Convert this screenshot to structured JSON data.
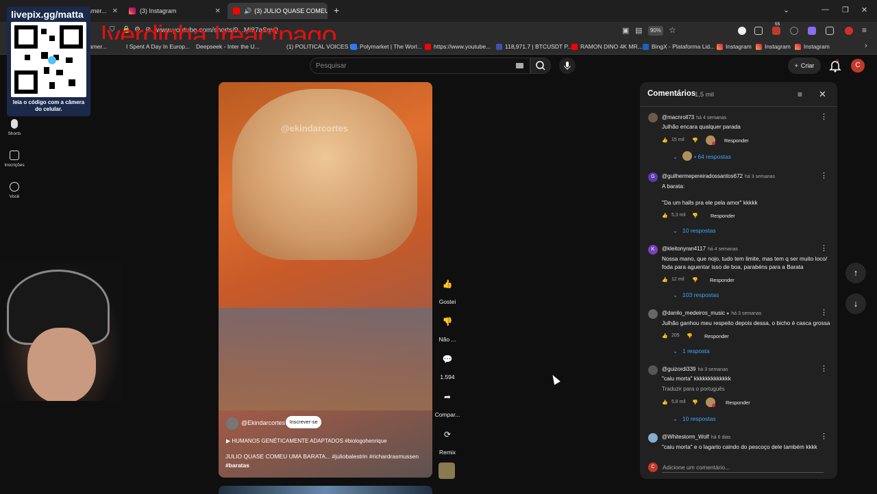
{
  "browser": {
    "tabs": [
      {
        "label": "amer..."
      },
      {
        "label": "(3) Instagram"
      },
      {
        "label": "(3) JULIO QUASE COMEU U"
      }
    ],
    "new_tab": "+",
    "url": "www.youtube.com/shorts/9...Mi87aSmQ",
    "zoom": "90%",
    "notification_ext_count": "55",
    "bookmarks": [
      "amer...",
      "I Spent A Day In Europ...",
      "Deepseek - Inter the U...",
      "(1) POLITICAL VOICES E...",
      "Polymarket | The Worl...",
      "https://www.youtube...",
      "118,971.7 | BTCUSDT P...",
      "RAMON DINO 4K MR...",
      "BingX - Plataforma Lid...",
      "Instagram",
      "Instagram",
      "Instagram"
    ]
  },
  "overlay": {
    "red_text": "!verdinha !reactpago",
    "qr_title": "livepix.gg/matta",
    "qr_caption": "leia o código com a câmera do celular."
  },
  "youtube": {
    "search_placeholder": "Pesquisar",
    "create_label": "Criar",
    "notif_count": "3",
    "avatar_letter": "C",
    "left_nav": [
      {
        "label": "Shorts"
      },
      {
        "label": "Inscrições"
      },
      {
        "label": "Você"
      }
    ]
  },
  "video": {
    "watermark": "@ekindarcortes",
    "channel": "@Ekindarcortes",
    "subscribe": "Inscrever-se",
    "song": "HUMANOS GENÉTICAMENTE ADAPTADOS #biologohenrique",
    "title_line1": "JULIO QUASE COMEU UMA BARATA... #juliobalestrin #richardrasmussen",
    "title_line2": "#baratas"
  },
  "actions": {
    "like": "Gostei",
    "dislike": "Não ...",
    "comments": "1.594",
    "share": "Compar...",
    "remix": "Remix"
  },
  "comments": {
    "title": "Comentários",
    "count": "1,5 mil",
    "input_placeholder": "Adicione um comentário...",
    "reply_label": "Responder",
    "translate_label": "Traduzir para o português",
    "items": [
      {
        "user": "@macnroll73",
        "time": "há 4 semanas",
        "text1": "Julhão encara qualquer parada",
        "text2": "",
        "text3": "",
        "likes": "15 mil",
        "more": "• 64 respostas",
        "avatar": "",
        "avatar_color": "#6b5b4b"
      },
      {
        "user": "@guilhermepereiradossantos672",
        "time": "há 3 semanas",
        "text1": "A barata:",
        "text2": "",
        "text3": "\"Da um halls pra ele pela amor\" kkkkk",
        "likes": "5,3 mil",
        "more": "10 respostas",
        "avatar": "G",
        "avatar_color": "#5b3bb0"
      },
      {
        "user": "@kleitonyran4117",
        "time": "há 4 semanas",
        "text1": "Nossa mano, que nojo, tudo tem limite, mas tem q ser muito loco/",
        "text2": "foda para aguentar isso de boa, parabéns para a Barata",
        "text3": "",
        "likes": "12 mil",
        "more": "103 respostas",
        "avatar": "K",
        "avatar_color": "#7b3fc0"
      },
      {
        "user": "@danilo_medeiros_music",
        "time": "há 3 semanas",
        "text1": "Julhão ganhou meu respeito depois dessa, o bicho é casca grossa",
        "text2": "",
        "text3": "",
        "likes": "205",
        "more": "1 resposta",
        "avatar": "",
        "avatar_color": "#666"
      },
      {
        "user": "@guizordi339",
        "time": "há 3 semanas",
        "text1": "\"caiu morta\" kkkkkkkkkkkkk",
        "text2": "",
        "text3": "",
        "likes": "5,8 mil",
        "more": "10 respostas",
        "avatar": "",
        "avatar_color": "#555"
      },
      {
        "user": "@Whitestorm_Wolf",
        "time": "há 6 dias",
        "text1": "\"caiu morta\" e o lagarto caindo do pescoço dele também kkkk",
        "text2": "",
        "text3": "",
        "likes": "",
        "more": "",
        "avatar": "",
        "avatar_color": "#88aacc"
      }
    ]
  },
  "colors": {
    "background": "#0f0f0f",
    "panel": "#212121",
    "link_blue": "#3ea6ff",
    "overlay_red": "#e01010",
    "avatar_red": "#c0392b"
  }
}
